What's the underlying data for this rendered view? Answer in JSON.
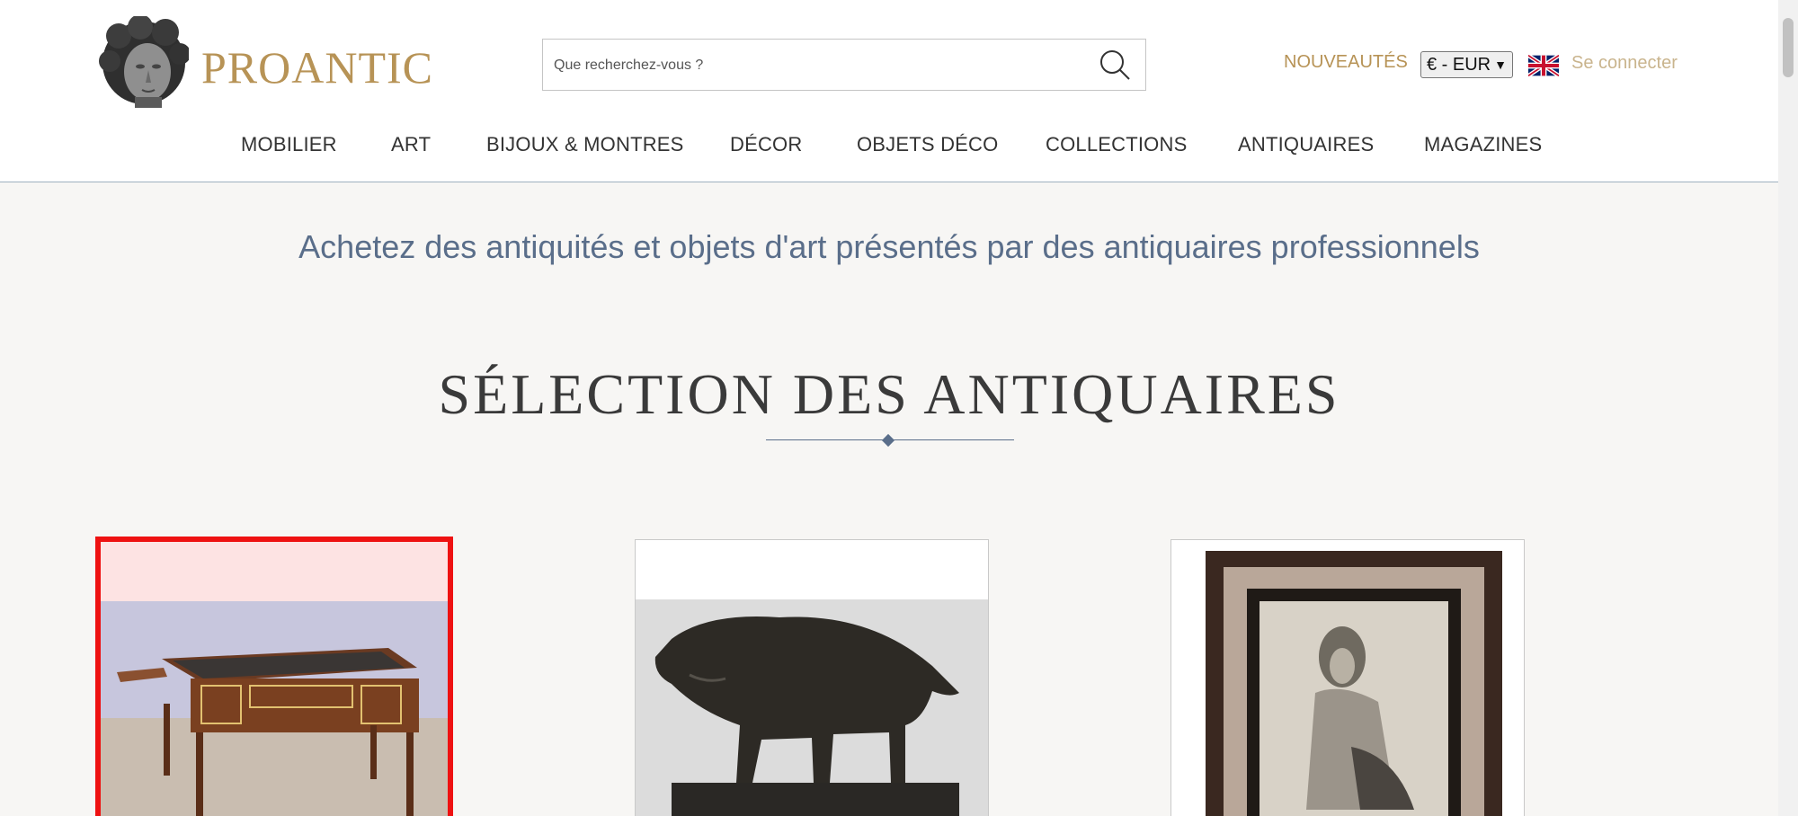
{
  "header": {
    "logo_text": "PROANTIC",
    "search_placeholder": "Que recherchez-vous ?",
    "nouveautes": "NOUVEAUTÉS",
    "currency": "€ - EUR",
    "language_flag": "uk-flag-icon",
    "login": "Se connecter"
  },
  "nav": {
    "items": [
      "MOBILIER",
      "ART",
      "BIJOUX & MONTRES",
      "DÉCOR",
      "OBJETS DÉCO",
      "COLLECTIONS",
      "ANTIQUAIRES",
      "MAGAZINES"
    ]
  },
  "main": {
    "tagline": "Achetez des antiquités et objets d'art présentés par des antiquaires professionnels",
    "section_title": "SÉLECTION DES ANTIQUAIRES"
  },
  "colors": {
    "brand_gold": "#b79356",
    "accent_blue": "#5a6e8a",
    "highlight_red": "#ee1111"
  }
}
